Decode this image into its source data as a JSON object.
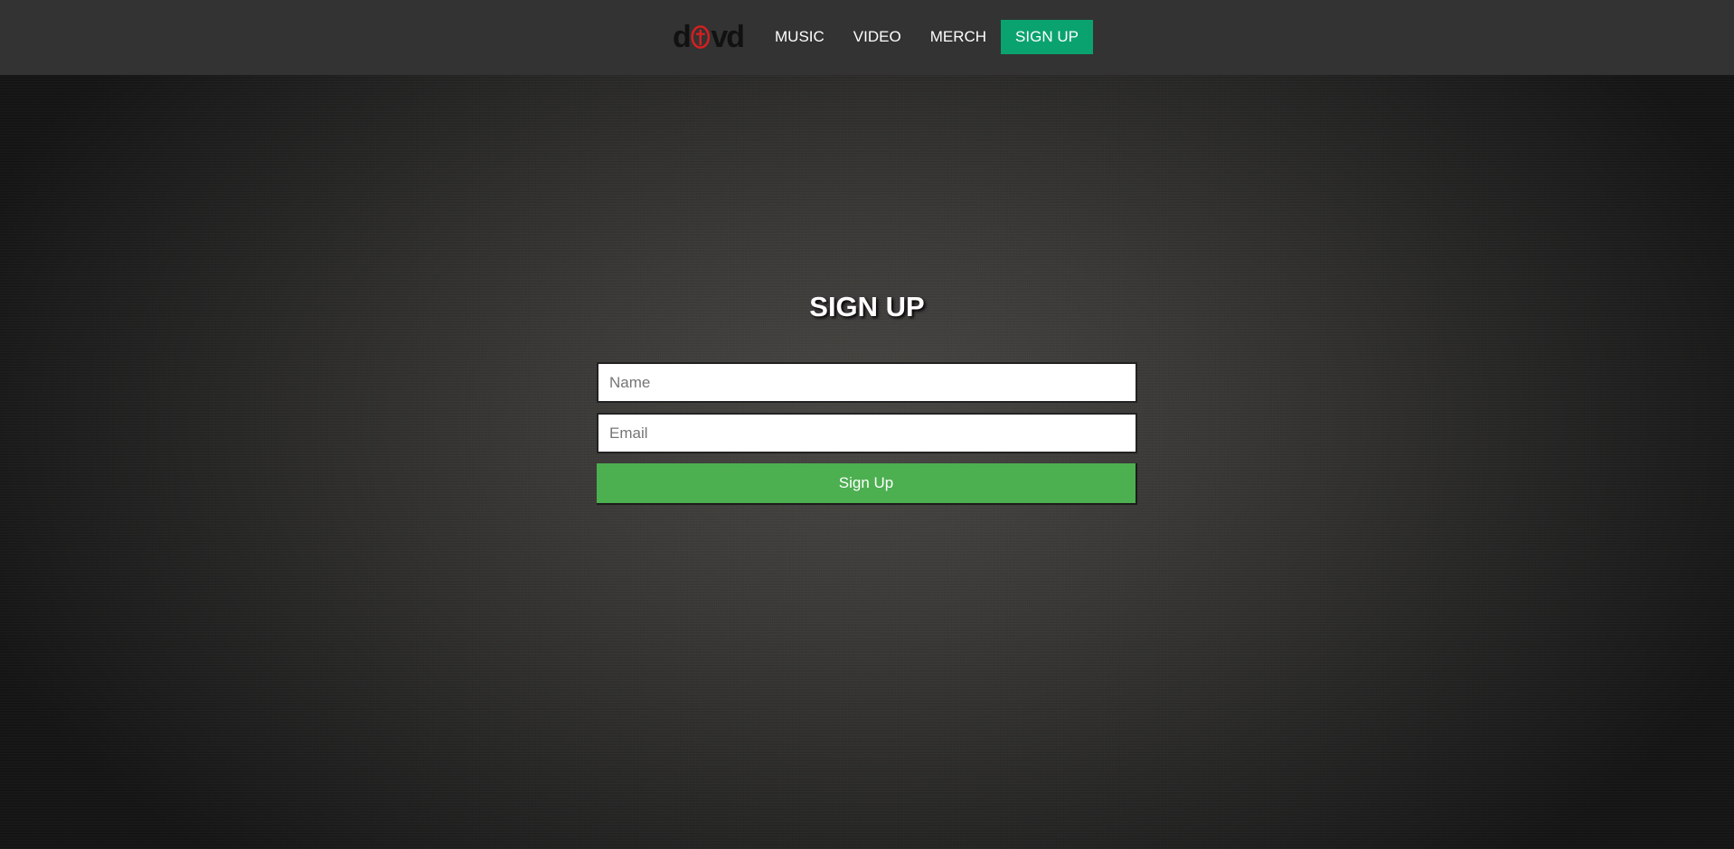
{
  "brand": {
    "logo_text": "d vd",
    "logo_mark_icon": "red-shield-icon",
    "logo_color": "#111111",
    "mark_color": "#d32020"
  },
  "nav": {
    "items": [
      {
        "label": "MUSIC"
      },
      {
        "label": "VIDEO"
      },
      {
        "label": "MERCH"
      },
      {
        "label": "SIGN UP",
        "active": true
      }
    ],
    "active_color": "#0aa36f"
  },
  "signup": {
    "title": "SIGN UP",
    "name_placeholder": "Name",
    "email_placeholder": "Email",
    "submit_label": "Sign Up",
    "submit_color": "#4caf50"
  }
}
